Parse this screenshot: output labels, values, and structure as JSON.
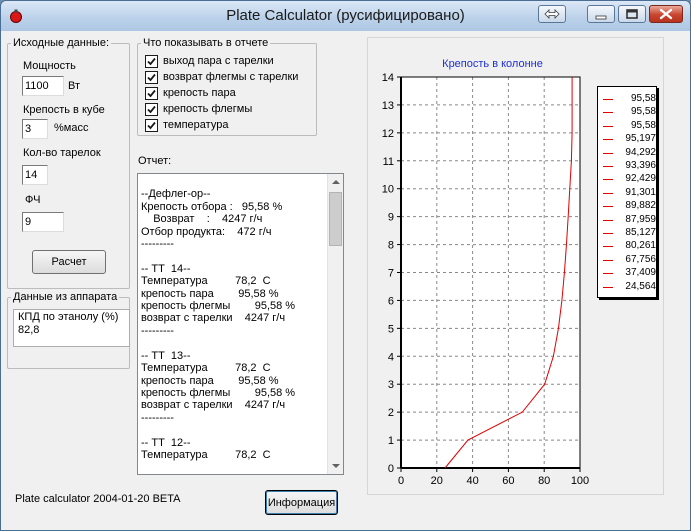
{
  "window": {
    "title": "Plate Calculator (русифицировано)"
  },
  "input_group": {
    "legend": "Исходные данные:",
    "power_label": "Мощность",
    "power_value": "1100",
    "power_unit": "Вт",
    "strength_label": "Крепость в кубе",
    "strength_value": "3",
    "strength_unit": "%масс",
    "plates_label": "Кол-во тарелок",
    "plates_value": "14",
    "fch_label": "ФЧ",
    "fch_value": "9",
    "calc_button": "Расчет"
  },
  "device_group": {
    "legend": "Данные из аппарата",
    "memo_line1": "КПД по этанолу (%)",
    "memo_line2": "82,8"
  },
  "report_options": {
    "legend": "Что показывать в отчете",
    "items": [
      {
        "label": "выход пара с тарелки",
        "checked": true
      },
      {
        "label": "возврат флегмы с тарелки",
        "checked": true
      },
      {
        "label": "крепость пара",
        "checked": true
      },
      {
        "label": "крепость флегмы",
        "checked": true
      },
      {
        "label": "температура",
        "checked": true
      }
    ]
  },
  "report": {
    "label": "Отчет:",
    "text": "\n--Дефлег-ор--\nКрепость отбора :   95,58 %\n    Возврат    :    4247 г/ч\nОтбор продукта:    472 г/ч\n---------\n\n-- ТТ  14--\nТемпература         78,2  С\nкрепость пара        95,58 %\nкрепость флегмы        95,58 %\nвозврат с тарелки    4247 г/ч\n---------\n\n-- ТТ  13--\nТемпература         78,2  С\nкрепость пара        95,58 %\nкрепость флегмы        95,58 %\nвозврат с тарелки    4247 г/ч\n---------\n\n-- ТТ  12--\nТемпература         78,2  С"
  },
  "footer": {
    "version": "Plate calculator 2004-01-20 BETA",
    "info_button": "Информация"
  },
  "colors": {
    "series": "#e00000",
    "title": "#1c2fd4"
  },
  "chart_data": {
    "type": "line",
    "title": "Крепость в колонне",
    "xlim": [
      0,
      100
    ],
    "ylim": [
      0,
      14
    ],
    "x_ticks": [
      "0",
      "20",
      "40",
      "60",
      "80",
      "100"
    ],
    "y_ticks": [
      "0",
      "1",
      "2",
      "3",
      "4",
      "5",
      "6",
      "7",
      "8",
      "9",
      "10",
      "11",
      "12",
      "13",
      "14"
    ],
    "grid": true,
    "legend_position": "right",
    "series": [
      {
        "x": [
          24.564,
          37.409,
          67.756,
          80.261,
          85.127,
          87.959,
          89.882,
          91.301,
          92.429,
          93.396,
          94.292,
          95.197,
          95.58,
          95.58,
          95.58
        ],
        "y": [
          0,
          1,
          2,
          3,
          4,
          5,
          6,
          7,
          8,
          9,
          10,
          11,
          12,
          13,
          14
        ]
      }
    ],
    "legend_entries": [
      "95,58",
      "95,58",
      "95,58",
      "95,197",
      "94,292",
      "93,396",
      "92,429",
      "91,301",
      "89,882",
      "87,959",
      "85,127",
      "80,261",
      "67,756",
      "37,409",
      "24,564"
    ]
  }
}
